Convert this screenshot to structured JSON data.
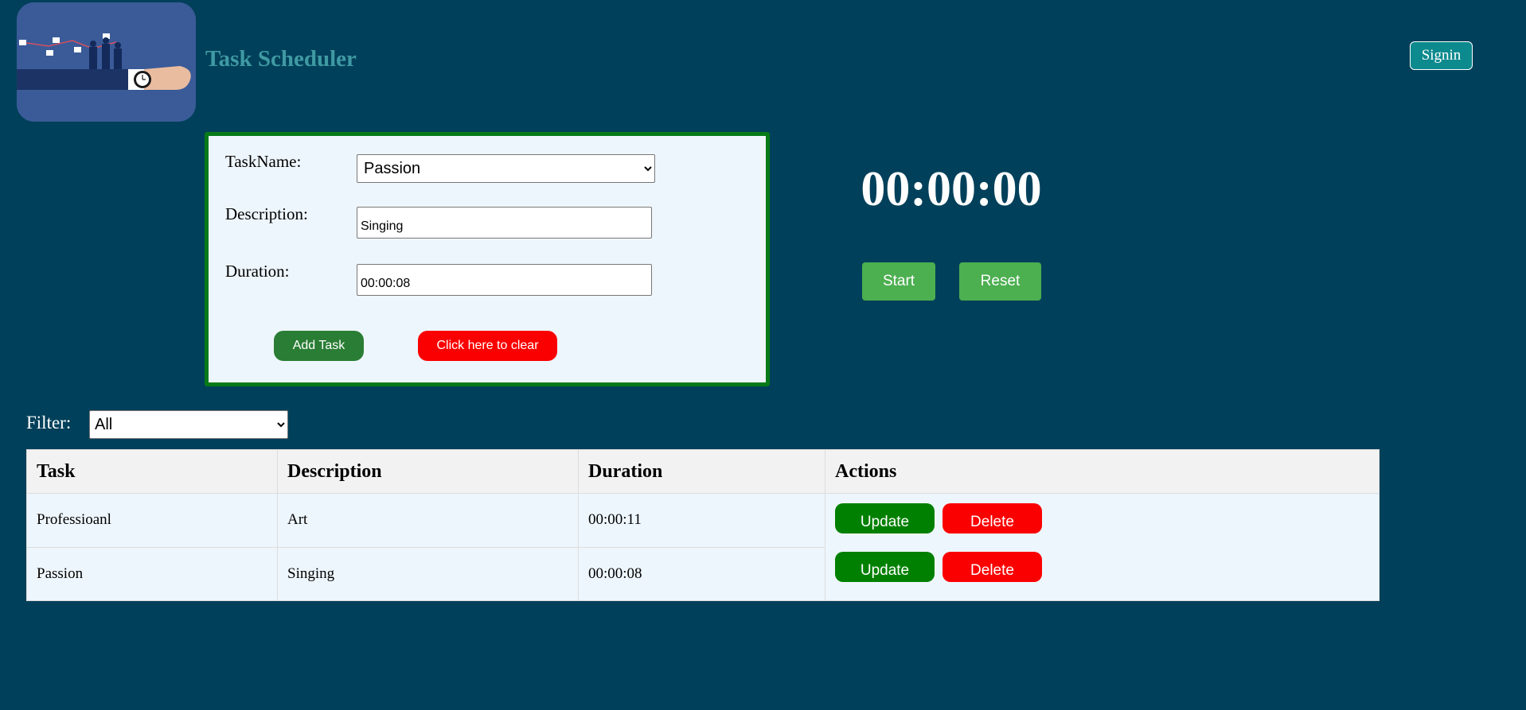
{
  "header": {
    "title": "Task Scheduler",
    "signin_label": "Signin",
    "logo_icon": "task-scheduler-logo-icon"
  },
  "form": {
    "task_name_label": "TaskName:",
    "task_name_selected": "Passion",
    "description_label": "Description:",
    "description_value": "Singing",
    "duration_label": "Duration:",
    "duration_value": "00:00:08",
    "add_task_label": "Add Task",
    "clear_label": "Click here to clear"
  },
  "timer": {
    "display": "00:00:00",
    "start_label": "Start",
    "reset_label": "Reset"
  },
  "filter": {
    "label": "Filter:",
    "selected": "All"
  },
  "table": {
    "headers": [
      "Task",
      "Description",
      "Duration",
      "Actions"
    ],
    "rows": [
      {
        "task": "Professioanl",
        "description": "Art",
        "duration": "00:00:11"
      },
      {
        "task": "Passion",
        "description": "Singing",
        "duration": "00:00:08"
      }
    ],
    "update_label": "Update",
    "delete_label": "Delete"
  },
  "colors": {
    "background": "#01405a",
    "title": "#3f9aa3",
    "form_border": "#067a17",
    "add_button": "#2a7d34",
    "clear_button": "#fb0000",
    "timer_button": "#4caf50",
    "update_button": "#008000",
    "delete_button": "#fb0000"
  }
}
